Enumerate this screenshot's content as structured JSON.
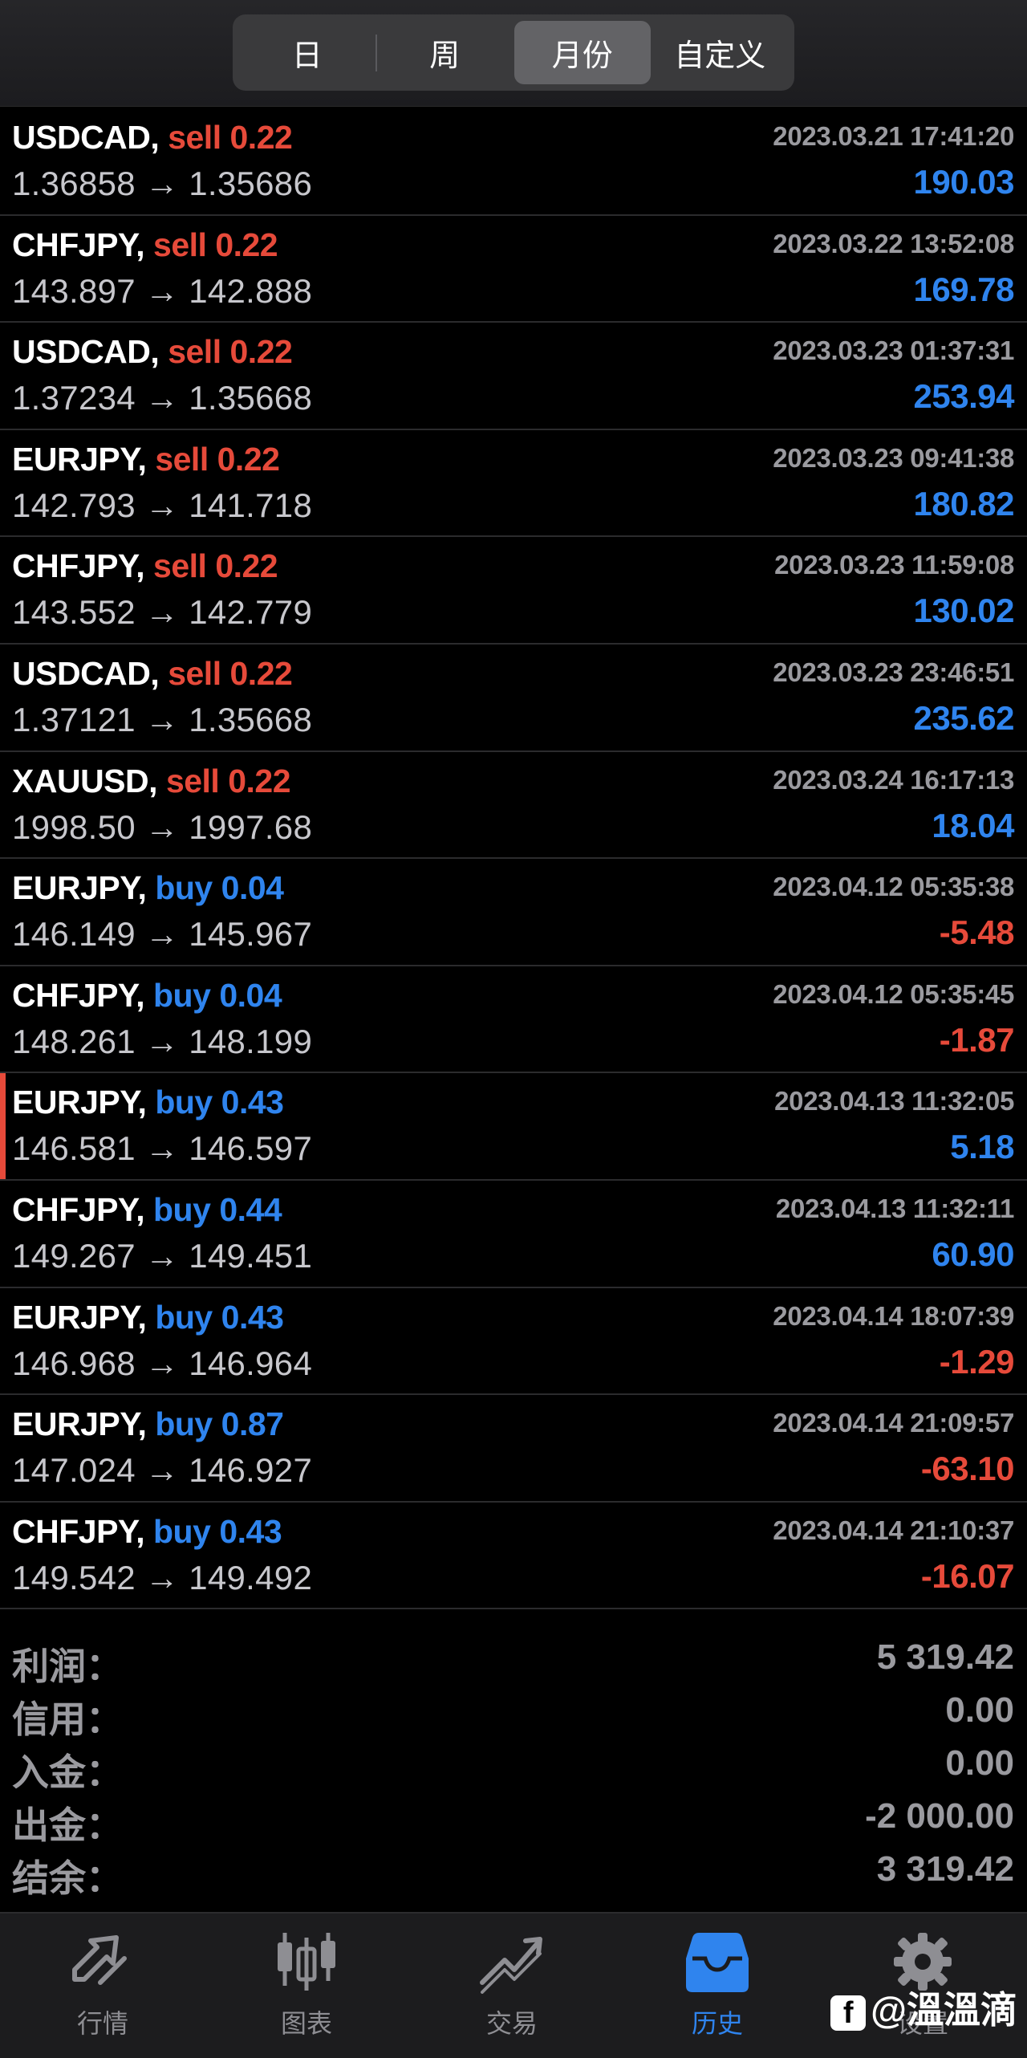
{
  "segments": [
    {
      "label": "日",
      "active": false
    },
    {
      "label": "周",
      "active": false
    },
    {
      "label": "月份",
      "active": true
    },
    {
      "label": "自定义",
      "active": false
    }
  ],
  "trades": [
    {
      "symbol": "USDCAD,",
      "side": "sell",
      "volume": "0.22",
      "open": "1.36858",
      "close": "1.35686",
      "time": "2023.03.21 17:41:20",
      "profit": "190.03",
      "sign": "pos"
    },
    {
      "symbol": "CHFJPY,",
      "side": "sell",
      "volume": "0.22",
      "open": "143.897",
      "close": "142.888",
      "time": "2023.03.22 13:52:08",
      "profit": "169.78",
      "sign": "pos"
    },
    {
      "symbol": "USDCAD,",
      "side": "sell",
      "volume": "0.22",
      "open": "1.37234",
      "close": "1.35668",
      "time": "2023.03.23 01:37:31",
      "profit": "253.94",
      "sign": "pos"
    },
    {
      "symbol": "EURJPY,",
      "side": "sell",
      "volume": "0.22",
      "open": "142.793",
      "close": "141.718",
      "time": "2023.03.23 09:41:38",
      "profit": "180.82",
      "sign": "pos"
    },
    {
      "symbol": "CHFJPY,",
      "side": "sell",
      "volume": "0.22",
      "open": "143.552",
      "close": "142.779",
      "time": "2023.03.23 11:59:08",
      "profit": "130.02",
      "sign": "pos"
    },
    {
      "symbol": "USDCAD,",
      "side": "sell",
      "volume": "0.22",
      "open": "1.37121",
      "close": "1.35668",
      "time": "2023.03.23 23:46:51",
      "profit": "235.62",
      "sign": "pos"
    },
    {
      "symbol": "XAUUSD,",
      "side": "sell",
      "volume": "0.22",
      "open": "1998.50",
      "close": "1997.68",
      "time": "2023.03.24 16:17:13",
      "profit": "18.04",
      "sign": "pos"
    },
    {
      "symbol": "EURJPY,",
      "side": "buy",
      "volume": "0.04",
      "open": "146.149",
      "close": "145.967",
      "time": "2023.04.12 05:35:38",
      "profit": "-5.48",
      "sign": "neg"
    },
    {
      "symbol": "CHFJPY,",
      "side": "buy",
      "volume": "0.04",
      "open": "148.261",
      "close": "148.199",
      "time": "2023.04.12 05:35:45",
      "profit": "-1.87",
      "sign": "neg"
    },
    {
      "symbol": "EURJPY,",
      "side": "buy",
      "volume": "0.43",
      "open": "146.581",
      "close": "146.597",
      "time": "2023.04.13 11:32:05",
      "profit": "5.18",
      "sign": "pos",
      "marked": true
    },
    {
      "symbol": "CHFJPY,",
      "side": "buy",
      "volume": "0.44",
      "open": "149.267",
      "close": "149.451",
      "time": "2023.04.13 11:32:11",
      "profit": "60.90",
      "sign": "pos"
    },
    {
      "symbol": "EURJPY,",
      "side": "buy",
      "volume": "0.43",
      "open": "146.968",
      "close": "146.964",
      "time": "2023.04.14 18:07:39",
      "profit": "-1.29",
      "sign": "neg"
    },
    {
      "symbol": "EURJPY,",
      "side": "buy",
      "volume": "0.87",
      "open": "147.024",
      "close": "146.927",
      "time": "2023.04.14 21:09:57",
      "profit": "-63.10",
      "sign": "neg"
    },
    {
      "symbol": "CHFJPY,",
      "side": "buy",
      "volume": "0.43",
      "open": "149.542",
      "close": "149.492",
      "time": "2023.04.14 21:10:37",
      "profit": "-16.07",
      "sign": "neg"
    }
  ],
  "arrow": "→",
  "summary": {
    "profit_label": "利润：",
    "profit_value": "5 319.42",
    "credit_label": "信用：",
    "credit_value": "0.00",
    "deposit_label": "入金：",
    "deposit_value": "0.00",
    "withdrawal_label": "出金：",
    "withdrawal_value": "-2 000.00",
    "balance_label": "结余：",
    "balance_value": "3 319.42"
  },
  "tabs": [
    {
      "label": "行情",
      "icon": "quotes-icon",
      "active": false
    },
    {
      "label": "图表",
      "icon": "chart-candles-icon",
      "active": false
    },
    {
      "label": "交易",
      "icon": "trade-icon",
      "active": false
    },
    {
      "label": "历史",
      "icon": "history-inbox-icon",
      "active": true
    },
    {
      "label": "设置",
      "icon": "gear-icon",
      "active": false
    }
  ],
  "watermark": "@溫溫滴",
  "colors": {
    "sell": "#e64a3a",
    "buy": "#2f84ee",
    "positive": "#2f84ee",
    "negative": "#e64a3a",
    "active_tab": "#2f84ee"
  }
}
